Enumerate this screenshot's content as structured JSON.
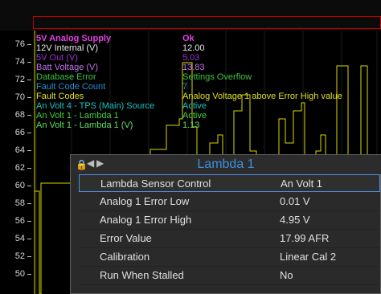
{
  "y_axis": [
    "76",
    "74",
    "72",
    "70",
    "68",
    "66",
    "64",
    "62",
    "60",
    "58",
    "56",
    "54",
    "52",
    "50"
  ],
  "status_rows": [
    {
      "key": "5V Analog Supply",
      "value": "Ok",
      "color": "#e040e0",
      "bold": true
    },
    {
      "key": "12V Internal (V)",
      "value": "12.00",
      "color": "#e8e8e8",
      "bold": false
    },
    {
      "key": "5V Out (V)",
      "value": "5.03",
      "color": "#9b30d0",
      "bold": false
    },
    {
      "key": "Batt Voltage (V)",
      "value": "13.83",
      "color": "#c070f0",
      "bold": false
    },
    {
      "key": "Database Error",
      "value": "Settings Overflow",
      "color": "#40c040",
      "bold": false
    },
    {
      "key": "Fault Code Count",
      "value": "7",
      "color": "#2090d0",
      "bold": false
    },
    {
      "key": "Fault Codes",
      "value": "Analog Voltage 1 above Error High value",
      "color": "#e0e020",
      "bold": false
    },
    {
      "key": "An Volt 4 - TPS (Main) Source",
      "value": "Active",
      "color": "#20c0c0",
      "bold": false
    },
    {
      "key": "An Volt 1 - Lambda 1",
      "value": "Active",
      "color": "#40d040",
      "bold": false
    },
    {
      "key": "An Volt 1 - Lambda 1 (V)",
      "value": "1.13",
      "color": "#60e060",
      "bold": false
    }
  ],
  "panel": {
    "title": "Lambda 1",
    "lock_icon": "🔒",
    "prev_icon": "◀",
    "next_icon": "▶",
    "rows": [
      {
        "key": "Lambda Sensor Control",
        "value": "An Volt 1",
        "selected": true
      },
      {
        "key": "Analog 1 Error Low",
        "value": "0.01 V",
        "selected": false
      },
      {
        "key": "Analog 1 Error High",
        "value": "4.95 V",
        "selected": false
      },
      {
        "key": "Error Value",
        "value": "17.99 AFR",
        "selected": false
      },
      {
        "key": "Calibration",
        "value": "Linear Cal 2",
        "selected": false
      },
      {
        "key": "Run When Stalled",
        "value": "No",
        "selected": false
      }
    ]
  },
  "colors": {
    "trace": "#d8d800",
    "accent": "#3d8fe0",
    "frame": "#c00000"
  }
}
